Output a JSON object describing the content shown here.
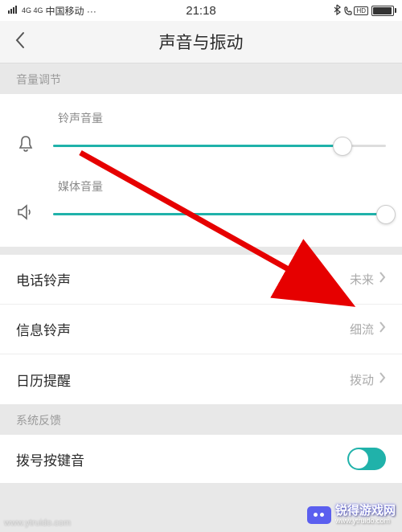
{
  "status": {
    "signal_label": "4G 4G",
    "carrier": "中国移动 ···",
    "time": "21:18",
    "hd": "HD"
  },
  "header": {
    "title": "声音与振动"
  },
  "sections": {
    "volume": "音量调节",
    "feedback": "系统反馈"
  },
  "sliders": {
    "ringtone": {
      "label": "铃声音量",
      "value": 87
    },
    "media": {
      "label": "媒体音量",
      "value": 100
    }
  },
  "rows": {
    "phone_ringtone": {
      "label": "电话铃声",
      "value": "未来"
    },
    "message_ringtone": {
      "label": "信息铃声",
      "value": "细流"
    },
    "calendar_alert": {
      "label": "日历提醒",
      "value": "拨动"
    },
    "dialpad_tone": {
      "label": "拨号按键音",
      "on": true
    }
  },
  "watermark": {
    "bl": "www.ytruido.com",
    "text": "锐得游戏网",
    "url": "www.ytruido.com"
  }
}
